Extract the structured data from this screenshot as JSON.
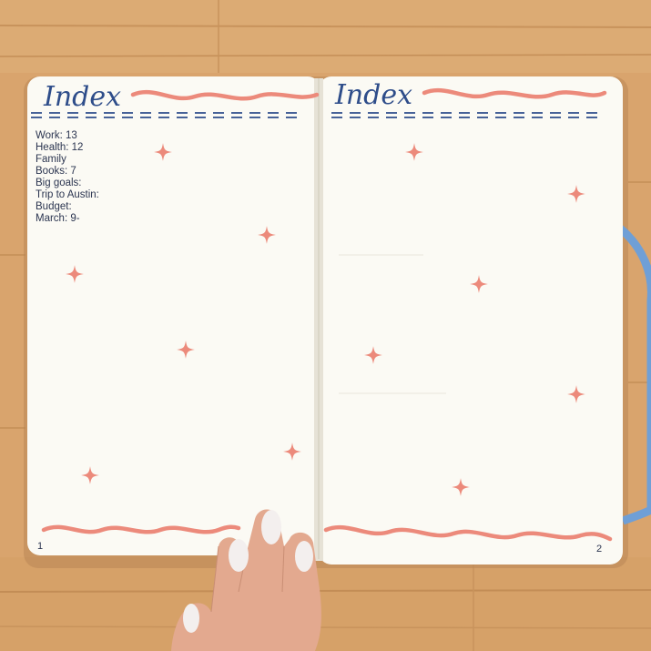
{
  "left_page": {
    "title": "Index",
    "entries": [
      "Work: 13",
      "Health: 12",
      "Family",
      "Books: 7",
      "Big goals:",
      "Trip to Austin:",
      "Budget:",
      "March: 9-"
    ],
    "page_number": "1"
  },
  "right_page": {
    "title": "Index",
    "page_number": "2"
  },
  "colors": {
    "wood": "#d9a46d",
    "paper": "#fbfaf4",
    "accent_coral": "#ec8a7b",
    "ink_blue": "#2e4d8a",
    "ribbon_blue": "#6f9fd6"
  },
  "icons": [
    "sparkle-star-icon",
    "wavy-line-border",
    "hand"
  ]
}
